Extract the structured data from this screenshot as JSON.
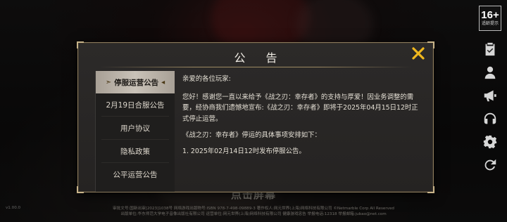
{
  "dialog": {
    "title": "公 告",
    "close_icon": "close-x-icon"
  },
  "tabs": [
    {
      "label": "停服运营公告",
      "active": true
    },
    {
      "label": "2月19日合服公告",
      "active": false
    },
    {
      "label": "用户协议",
      "active": false
    },
    {
      "label": "隐私政策",
      "active": false
    },
    {
      "label": "公平运营公告",
      "active": false
    }
  ],
  "content": {
    "greeting": "亲爱的各位玩家:",
    "paragraph1": "您好！感谢您一直以来给予《战之刃：幸存者》的支持与厚爱！因业务调整的需要，经协商我们遗憾地宣布:《战之刃：幸存者》即将于2025年04月15日12时正式停止运营。",
    "paragraph2": "《战之刃：幸存者》停运的具体事项安排如下：",
    "item1": "1. 2025年02月14日12时发布停服公告。"
  },
  "side_icons": {
    "age_rating": "16+",
    "age_rating_label": "适龄提示",
    "icons": [
      "clipboard-check-icon",
      "user-icon",
      "megaphone-icon",
      "headset-icon",
      "gear-icon",
      "refresh-icon"
    ]
  },
  "bottom": {
    "tap_prompt": "点击屏幕",
    "footer_line1": "审批文号:国新出审[2023]1038号 网络游戏出版物号:ISBN 978-7-498-09889-3 著作权人:网元世界(上海)网络科技有限公司 ©Netmarble Corp All Reserved",
    "footer_line2": "出版单位:华东师范大学电子音像出版社有限公司 运营单位:网元世界(上海)网络科技有限公司 健康游戏忠告 举报电话:12318 举报邮箱:jubao@net.com",
    "version": "v1.00.0"
  }
}
